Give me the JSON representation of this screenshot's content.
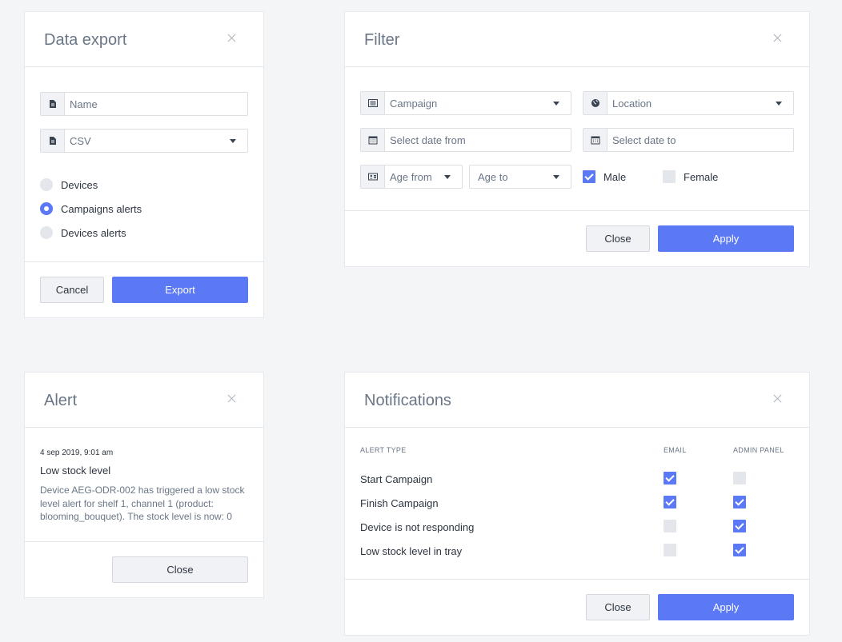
{
  "export_modal": {
    "title": "Data export",
    "name_placeholder": "Name",
    "format_value": "CSV",
    "options": [
      "Devices",
      "Campaigns alerts",
      "Devices alerts"
    ],
    "selected_option": "Campaigns alerts",
    "cancel_label": "Cancel",
    "export_label": "Export"
  },
  "filter_modal": {
    "title": "Filter",
    "campaign_value": "Campaign",
    "location_value": "Location",
    "date_from_placeholder": "Select date from",
    "date_to_placeholder": "Select date to",
    "age_from_value": "Age from",
    "age_to_value": "Age to",
    "male_label": "Male",
    "male_checked": true,
    "female_label": "Female",
    "female_checked": false,
    "close_label": "Close",
    "apply_label": "Apply"
  },
  "alert_modal": {
    "title": "Alert",
    "timestamp": "4 sep 2019, 9:01 am",
    "heading": "Low stock level",
    "message": "Device AEG-ODR-002 has triggered a low stock level alert for shelf 1, channel 1 (product: blooming_bouquet). The stock level is now: 0",
    "close_label": "Close"
  },
  "notifications_modal": {
    "title": "Notifications",
    "headers": {
      "type": "ALERT TYPE",
      "email": "EMAIL",
      "admin": "ADMIN PANEL"
    },
    "rows": [
      {
        "label": "Start Campaign",
        "email": true,
        "admin": false
      },
      {
        "label": "Finish Campaign",
        "email": true,
        "admin": true
      },
      {
        "label": "Device is not responding",
        "email": false,
        "admin": true
      },
      {
        "label": "Low stock level in tray",
        "email": false,
        "admin": true
      }
    ],
    "close_label": "Close",
    "apply_label": "Apply"
  },
  "theme": {
    "accent": "#5b78f5",
    "page_bg": "#f4f5f7",
    "title_color": "#6a7686"
  },
  "icons": {
    "file": "file-icon",
    "list": "list-icon",
    "globe": "globe-icon",
    "calendar": "calendar-icon",
    "id_card": "id-card-icon",
    "close": "close-icon",
    "caret": "chevron-down-icon"
  }
}
